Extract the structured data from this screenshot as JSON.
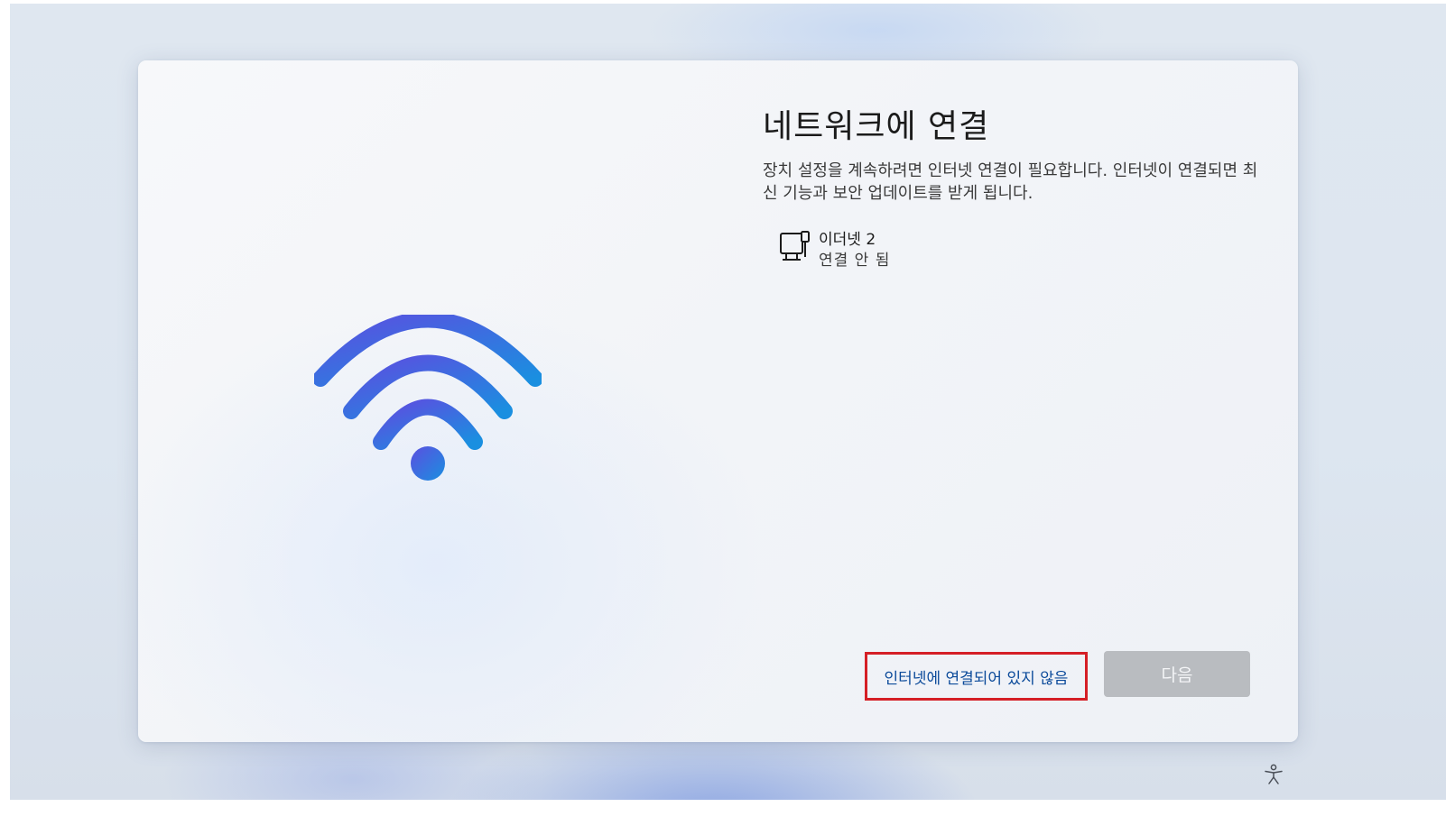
{
  "setup": {
    "title": "네트워크에 연결",
    "description": "장치 설정을 계속하려면 인터넷 연결이 필요합니다. 인터넷이 연결되면 최신 기능과 보안 업데이트를 받게 됩니다.",
    "hero_icon": "wifi-icon",
    "network": {
      "icon": "ethernet-icon",
      "name": "이더넷 2",
      "status": "연결 안 됨"
    },
    "skip_link": "인터넷에 연결되어 있지 않음",
    "next_button": "다음",
    "accessibility_icon": "accessibility-icon",
    "colors": {
      "accent_blue": "#0b4a9a",
      "highlight_red": "#d51f26",
      "disabled_button": "#b9bcc0",
      "wifi_gradient_start": "#5b4fe0",
      "wifi_gradient_end": "#1a8fe0"
    }
  }
}
